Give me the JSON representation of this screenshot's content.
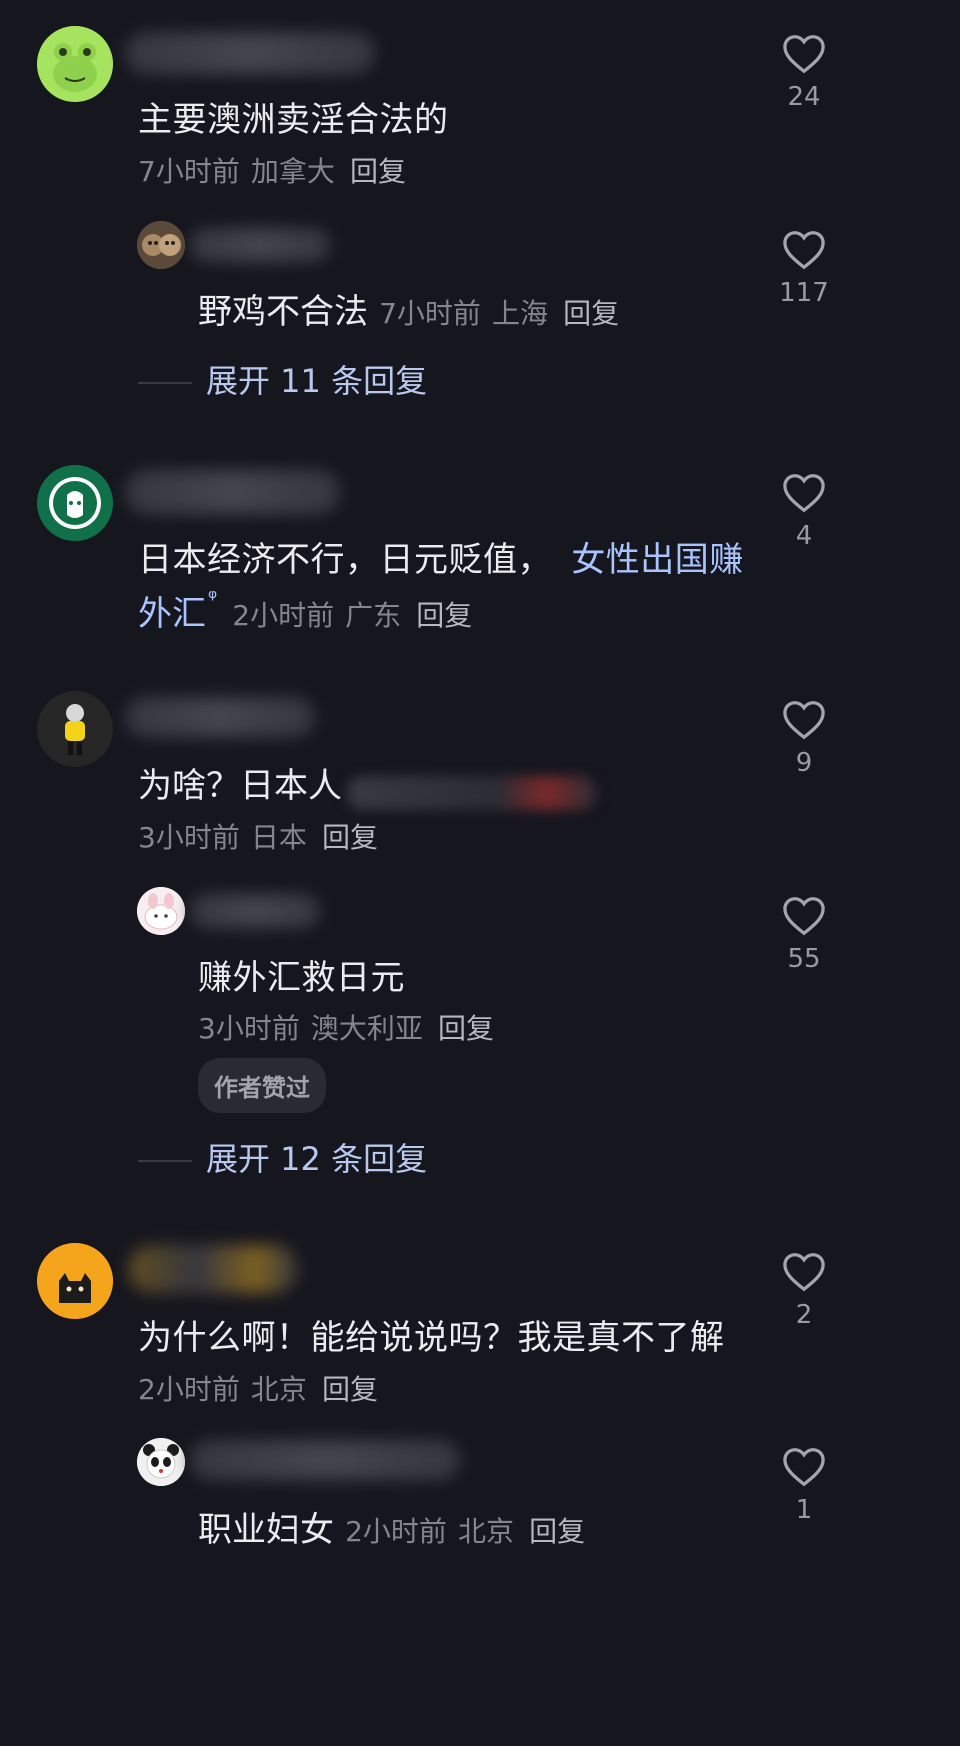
{
  "comments": [
    {
      "text": "主要澳洲卖淫合法的",
      "time": "7小时前",
      "location": "加拿大",
      "reply_label": "回复",
      "likes": "24",
      "avatar": "frog-avatar",
      "replies": [
        {
          "text": "野鸡不合法",
          "time": "7小时前",
          "location": "上海",
          "reply_label": "回复",
          "likes": "117",
          "avatar": "monkeys-avatar"
        }
      ],
      "expand_label": "展开 11 条回复"
    },
    {
      "text_line1_plain": "日本经济不行，日元贬值，",
      "text_link_part1": "女性出国赚",
      "text_link_part2": "外汇",
      "search_mark": "ᵠ",
      "time": "2小时前",
      "location": "广东",
      "reply_label": "回复",
      "likes": "4",
      "avatar": "starbucks-avatar"
    },
    {
      "text": "为啥？日本人",
      "time": "3小时前",
      "location": "日本",
      "reply_label": "回复",
      "likes": "9",
      "avatar": "yellow-hoodie-avatar",
      "replies": [
        {
          "text": "赚外汇救日元",
          "time": "3小时前",
          "location": "澳大利亚",
          "reply_label": "回复",
          "likes": "55",
          "badge": "作者赞过",
          "avatar": "pink-bunny-avatar"
        }
      ],
      "expand_label": "展开 12 条回复"
    },
    {
      "text": "为什么啊！能给说说吗？我是真不了解",
      "time": "2小时前",
      "location": "北京",
      "reply_label": "回复",
      "likes": "2",
      "avatar": "black-cat-avatar",
      "replies": [
        {
          "text": "职业妇女",
          "time": "2小时前",
          "location": "北京",
          "reply_label": "回复",
          "likes": "1",
          "avatar": "panda-avatar"
        }
      ]
    }
  ],
  "colors": {
    "background": "#16161e",
    "link": "#a9c4ff",
    "meta": "#85858f"
  }
}
